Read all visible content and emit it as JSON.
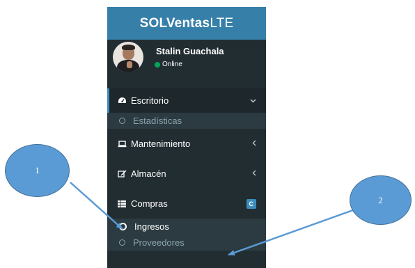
{
  "app": {
    "title_bold": "SOLVentas",
    "title_light": "LTE"
  },
  "user": {
    "name": "Stalin Guachala",
    "status": "Online"
  },
  "menu": {
    "escritorio": {
      "label": "Escritorio",
      "icon": "dashboard-icon"
    },
    "estadisticas": {
      "label": "Estadísticas"
    },
    "mantenimiento": {
      "label": "Mantenimiento",
      "icon": "laptop-icon"
    },
    "almacen": {
      "label": "Almacén",
      "icon": "edit-icon"
    },
    "compras": {
      "label": "Compras",
      "icon": "grid-icon",
      "badge": "C"
    },
    "ingresos": {
      "label": "Ingresos"
    },
    "proveedores": {
      "label": "Proveedores"
    }
  },
  "callouts": {
    "one": "1",
    "two": "2"
  },
  "colors": {
    "logo_bg": "#367fa9",
    "sidebar_bg": "#222d32",
    "accent": "#3c8dbc",
    "online": "#00a65a",
    "callout_fill": "#5b9bd5"
  }
}
